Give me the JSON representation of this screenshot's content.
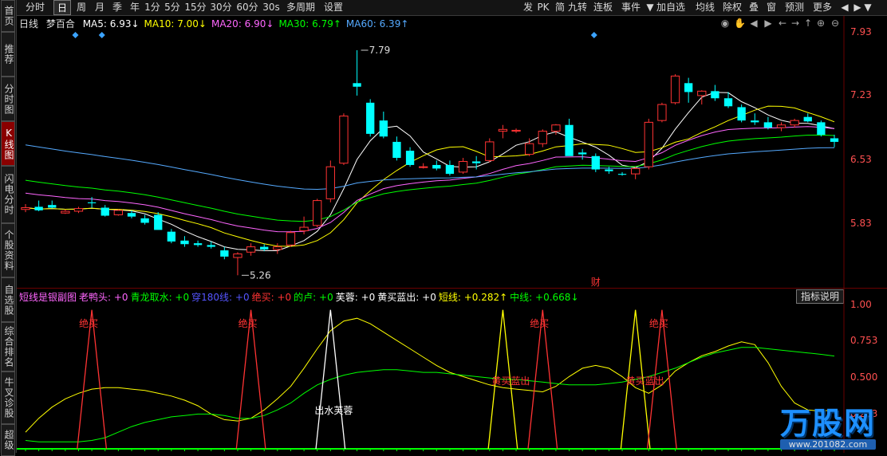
{
  "left_tabs": [
    "首页",
    "推荐",
    "分时图",
    "K线图",
    "闪电分时",
    "个股资料",
    "自选股",
    "综合排名",
    "牛叉诊股",
    "超级"
  ],
  "top_left": [
    "分时",
    "日",
    "周",
    "月",
    "季",
    "年",
    "1分",
    "5分",
    "15分",
    "30分",
    "60分",
    "30s",
    "多周期",
    "设置"
  ],
  "top_right": [
    "发",
    "PK",
    "简",
    "九转",
    "连板",
    "事件",
    "加自选",
    "均线",
    "除权",
    "叠",
    "窗",
    "预测",
    "更多"
  ],
  "stock": {
    "period": "日线",
    "name": "梦百合"
  },
  "ma_legend": [
    {
      "label": "MA5: 6.93↓",
      "color": "#ffffff"
    },
    {
      "label": "MA10: 7.00↓",
      "color": "#ffff00"
    },
    {
      "label": "MA20: 6.90↓",
      "color": "#ff66ff"
    },
    {
      "label": "MA30: 6.79↑",
      "color": "#00ff00"
    },
    {
      "label": "MA60: 6.39↑",
      "color": "#55aaff"
    }
  ],
  "indicator_legend": [
    {
      "label": "短线是银副图",
      "color": "#ff66ff"
    },
    {
      "label": "老鸭头: +0",
      "color": "#ff66ff"
    },
    {
      "label": "青龙取水: +0",
      "color": "#00ff00"
    },
    {
      "label": "穿180线: +0",
      "color": "#5555ff"
    },
    {
      "label": "绝买: +0",
      "color": "#ff3333"
    },
    {
      "label": "的卢: +0",
      "color": "#00ff00"
    },
    {
      "label": "芙蓉: +0",
      "color": "#ffffff"
    },
    {
      "label": "黄买蓝出: +0",
      "color": "#ffffff"
    },
    {
      "label": "短线: +0.282↑",
      "color": "#ffff00"
    },
    {
      "label": "中线: +0.668↓",
      "color": "#00ff00"
    }
  ],
  "explain_button": "指标说明",
  "price_axis": [
    "7.93",
    "7.23",
    "6.53",
    "5.83"
  ],
  "indicator_axis": [
    "1.00",
    "0.753",
    "0.500",
    "0.253"
  ],
  "annotations": {
    "high": "7.79",
    "low": "5.26",
    "cai": "财",
    "juemai": "绝买",
    "furong": "出水芙蓉",
    "huangmai": "黄买蓝出"
  },
  "watermark": {
    "brand": "万股网",
    "url": "www.201082.com"
  },
  "colors": {
    "up": "#ff3333",
    "down": "#00ffff",
    "bg": "#000000"
  },
  "chart_data": {
    "type": "candlestick",
    "ohlc": [
      [
        6.0,
        6.06,
        5.97,
        6.02
      ],
      [
        6.03,
        6.1,
        5.98,
        5.99
      ],
      [
        6.05,
        6.1,
        6.01,
        6.02
      ],
      [
        5.96,
        6.0,
        5.95,
        5.98
      ],
      [
        5.98,
        6.03,
        5.96,
        6.01
      ],
      [
        6.08,
        6.14,
        6.02,
        6.07
      ],
      [
        6.02,
        6.05,
        5.92,
        5.93
      ],
      [
        5.94,
        6.0,
        5.93,
        5.99
      ],
      [
        5.96,
        5.99,
        5.9,
        5.92
      ],
      [
        5.9,
        5.94,
        5.83,
        5.85
      ],
      [
        5.94,
        5.97,
        5.8,
        5.77
      ],
      [
        5.75,
        5.78,
        5.62,
        5.64
      ],
      [
        5.65,
        5.7,
        5.58,
        5.61
      ],
      [
        5.62,
        5.65,
        5.58,
        5.6
      ],
      [
        5.6,
        5.64,
        5.56,
        5.58
      ],
      [
        5.54,
        5.58,
        5.44,
        5.47
      ],
      [
        5.46,
        5.52,
        5.26,
        5.5
      ],
      [
        5.52,
        5.62,
        5.48,
        5.58
      ],
      [
        5.58,
        5.61,
        5.53,
        5.55
      ],
      [
        5.55,
        5.62,
        5.5,
        5.58
      ],
      [
        5.6,
        5.76,
        5.58,
        5.74
      ],
      [
        5.76,
        5.92,
        5.72,
        5.8
      ],
      [
        5.82,
        6.12,
        5.8,
        6.1
      ],
      [
        6.12,
        6.55,
        6.08,
        6.48
      ],
      [
        6.52,
        7.08,
        6.5,
        7.05
      ],
      [
        7.42,
        7.79,
        7.28,
        7.38
      ],
      [
        7.2,
        7.24,
        6.82,
        6.85
      ],
      [
        7.0,
        7.1,
        6.8,
        6.82
      ],
      [
        6.76,
        6.82,
        6.55,
        6.58
      ],
      [
        6.66,
        6.7,
        6.48,
        6.5
      ],
      [
        6.48,
        6.52,
        6.46,
        6.48
      ],
      [
        6.5,
        6.55,
        6.44,
        6.46
      ],
      [
        6.5,
        6.55,
        6.38,
        6.4
      ],
      [
        6.42,
        6.58,
        6.4,
        6.54
      ],
      [
        6.54,
        6.6,
        6.45,
        6.52
      ],
      [
        6.55,
        6.8,
        6.53,
        6.76
      ],
      [
        6.88,
        6.95,
        6.8,
        6.9
      ],
      [
        6.88,
        6.91,
        6.86,
        6.89
      ],
      [
        6.62,
        6.8,
        6.6,
        6.74
      ],
      [
        6.74,
        6.9,
        6.7,
        6.88
      ],
      [
        6.88,
        6.96,
        6.84,
        6.95
      ],
      [
        6.95,
        7.02,
        6.78,
        6.6
      ],
      [
        6.64,
        6.68,
        6.56,
        6.62
      ],
      [
        6.6,
        6.63,
        6.42,
        6.45
      ],
      [
        6.45,
        6.48,
        6.4,
        6.43
      ],
      [
        6.4,
        6.42,
        6.38,
        6.39
      ],
      [
        6.4,
        6.48,
        6.34,
        6.46
      ],
      [
        6.48,
        7.02,
        6.45,
        6.98
      ],
      [
        7.0,
        7.2,
        6.98,
        7.18
      ],
      [
        7.2,
        7.52,
        7.18,
        7.5
      ],
      [
        7.42,
        7.48,
        7.2,
        7.32
      ],
      [
        7.28,
        7.34,
        7.18,
        7.33
      ],
      [
        7.33,
        7.4,
        7.22,
        7.25
      ],
      [
        7.25,
        7.32,
        7.14,
        7.16
      ],
      [
        7.15,
        7.18,
        6.98,
        7.0
      ],
      [
        7.0,
        7.08,
        6.95,
        6.98
      ],
      [
        6.98,
        7.04,
        6.9,
        6.92
      ],
      [
        6.92,
        6.98,
        6.88,
        6.95
      ],
      [
        6.95,
        7.02,
        6.92,
        7.0
      ],
      [
        7.04,
        7.08,
        6.98,
        6.99
      ],
      [
        6.98,
        7.0,
        6.82,
        6.84
      ],
      [
        6.8,
        6.84,
        6.7,
        6.76
      ]
    ],
    "price_range": [
      5.2,
      8.05
    ],
    "indicator_range": [
      0,
      1.05
    ]
  }
}
